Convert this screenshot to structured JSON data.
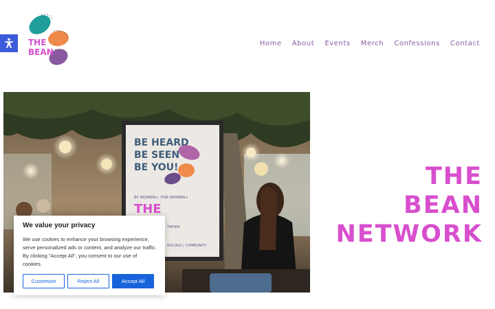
{
  "brand": {
    "logo_text": "THE BEAN",
    "logo_line1": "THE",
    "logo_line2": "BEAN"
  },
  "nav": {
    "items": [
      "Home",
      "About",
      "Events",
      "Merch",
      "Confessions",
      "Contact"
    ]
  },
  "hero": {
    "title_lines": [
      "THE",
      "BEAN",
      "NETWORK"
    ],
    "poster": {
      "headline": [
        "BE HEARD",
        "BE SEEN",
        "BE YOU!"
      ],
      "tagline": "BY WOMEN+, FOR WOMEN+",
      "brand_fragment": "THE",
      "footer_text": "SOCIALS | COMMUNITY",
      "network_fragment": "TWORK"
    }
  },
  "cookie_banner": {
    "title": "We value your privacy",
    "body": "We use cookies to enhance your browsing experience, serve personalized ads or content, and analyze our traffic. By clicking \"Accept All\", you consent to our use of cookies.",
    "customize_label": "Customize",
    "reject_label": "Reject All",
    "accept_label": "Accept All"
  },
  "colors": {
    "title_pink": "#d84fcd",
    "nav_purple": "#8a5aa0",
    "accessibility_blue": "#3b5bdb",
    "cookie_blue": "#1863dc",
    "bean_teal": "#1f9e9b",
    "bean_orange": "#f08a4b",
    "bean_purple": "#8a5aa0"
  },
  "icons": {
    "accessibility": "accessibility-icon"
  }
}
